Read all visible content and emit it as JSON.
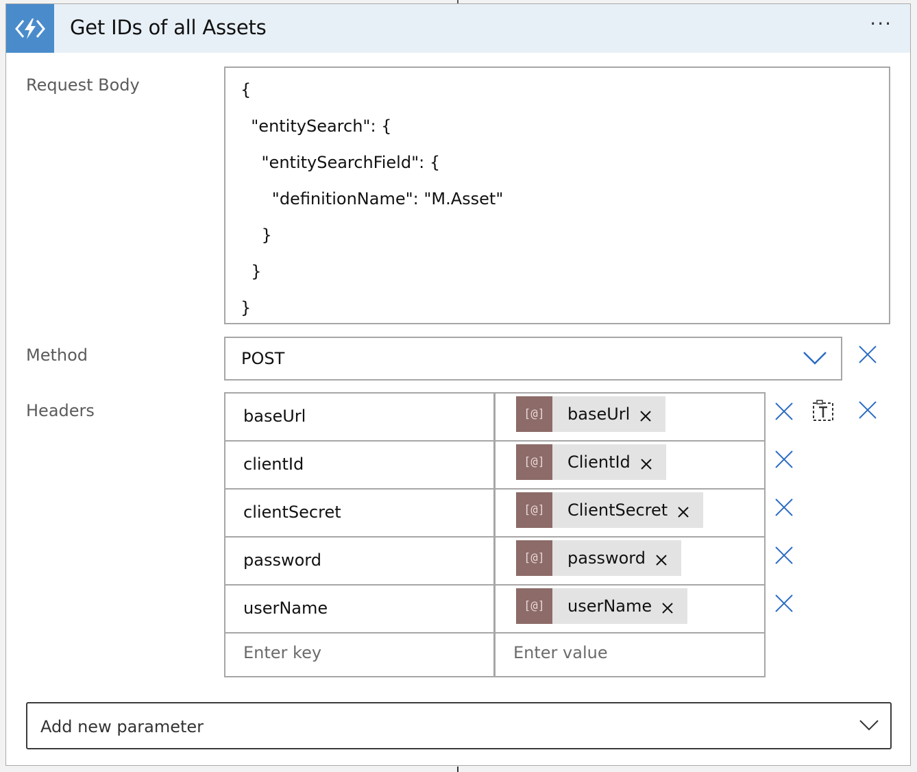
{
  "action": {
    "title": "Get IDs of all Assets",
    "icon": "azure-function-icon",
    "more_menu": "···"
  },
  "request_body": {
    "label": "Request Body",
    "lines": [
      "{",
      "  \"entitySearch\": {",
      "    \"entitySearchField\": {",
      "      \"definitionName\": \"M.Asset\"",
      "    }",
      "  }",
      "}"
    ]
  },
  "method": {
    "label": "Method",
    "value": "POST"
  },
  "headers": {
    "label": "Headers",
    "rows": [
      {
        "key": "baseUrl",
        "token_icon": "[@]",
        "token": "baseUrl"
      },
      {
        "key": "clientId",
        "token_icon": "[@]",
        "token": "ClientId"
      },
      {
        "key": "clientSecret",
        "token_icon": "[@]",
        "token": "ClientSecret"
      },
      {
        "key": "password",
        "token_icon": "[@]",
        "token": "password"
      },
      {
        "key": "userName",
        "token_icon": "[@]",
        "token": "userName"
      }
    ],
    "key_placeholder": "Enter key",
    "value_placeholder": "Enter value"
  },
  "add_parameter": {
    "label": "Add new parameter"
  },
  "colors": {
    "accent": "#4a8ccb",
    "header_bg": "#e8f0f7",
    "token_icon_bg": "#8c6b69",
    "x_icon": "#2b6cc4"
  }
}
